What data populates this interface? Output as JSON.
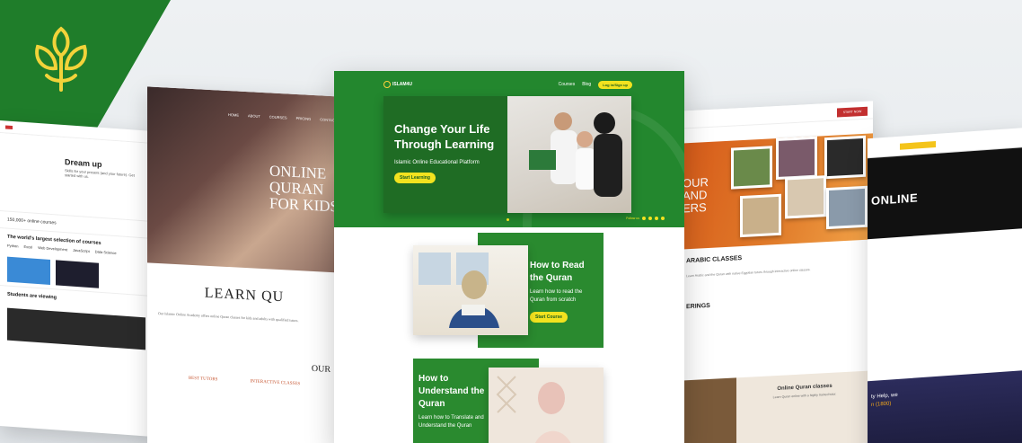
{
  "colors": {
    "brand_green": "#23872e",
    "dark_green": "#1f6c24",
    "accent_yellow": "#f2e21f",
    "orange": "#e07b2a"
  },
  "logo": {
    "icon": "tree-logo-icon"
  },
  "left_card": {
    "hero_title": "Dream up",
    "hero_desc": "Skills for your present (and your future). Get started with us.",
    "stat": "150,000+ online courses",
    "heading": "The world's largest selection of courses",
    "tabs": [
      "Python",
      "Excel",
      "Web Development",
      "JavaScript",
      "Data Science"
    ],
    "section": "Students are viewing"
  },
  "second_card": {
    "nav": [
      "HOME",
      "ABOUT",
      "COURSES",
      "PRICING",
      "CONTACT"
    ],
    "hero_title_line1": "ONLINE QURAN",
    "hero_title_line2": "FOR KIDS",
    "learn_title": "LEARN QU",
    "para": "Our Islamic Online Academy offers online Quran classes for kids and adults with qualified tutors.",
    "section": "OUR",
    "features": [
      "BEST TUTORS",
      "INTERACTIVE CLASSES"
    ]
  },
  "main": {
    "brand": "ISLAM4U",
    "nav_links": [
      "Courses",
      "Blog"
    ],
    "login_label": "Log in/Sign up",
    "banner": {
      "title_line1": "Change Your Life",
      "title_line2": "Through Learning",
      "subtitle": "Islamic Online Educational Platform",
      "button": "Start Learning"
    },
    "social_label": "Follow us",
    "course1": {
      "title_line1": "How to Read",
      "title_line2": "the Quran",
      "desc": "Learn how to read the Quran from scratch",
      "button": "Start Course"
    },
    "course2": {
      "title_line1": "How to",
      "title_line2": "Understand the",
      "title_line3": "Quran",
      "desc": "Learn how to Translate and Understand the Quran"
    }
  },
  "right_card": {
    "button": "START NOW",
    "hero_title_line1": "OUR",
    "hero_title_line2": "AND",
    "hero_title_line3": "ERS",
    "section": "ARABIC CLASSES",
    "para": "Learn Arabic and the Quran with native Egyptian tutors through interactive online classes.",
    "offerings": "ERINGS",
    "bottom_title": "Online Quran classes",
    "bottom_desc": "Learn Quran online with a highly trained tutor."
  },
  "far_right_card": {
    "hero_title": "ONLINE",
    "night_text_line1": "ty Help, we",
    "night_text_line2": "n (1800)"
  }
}
